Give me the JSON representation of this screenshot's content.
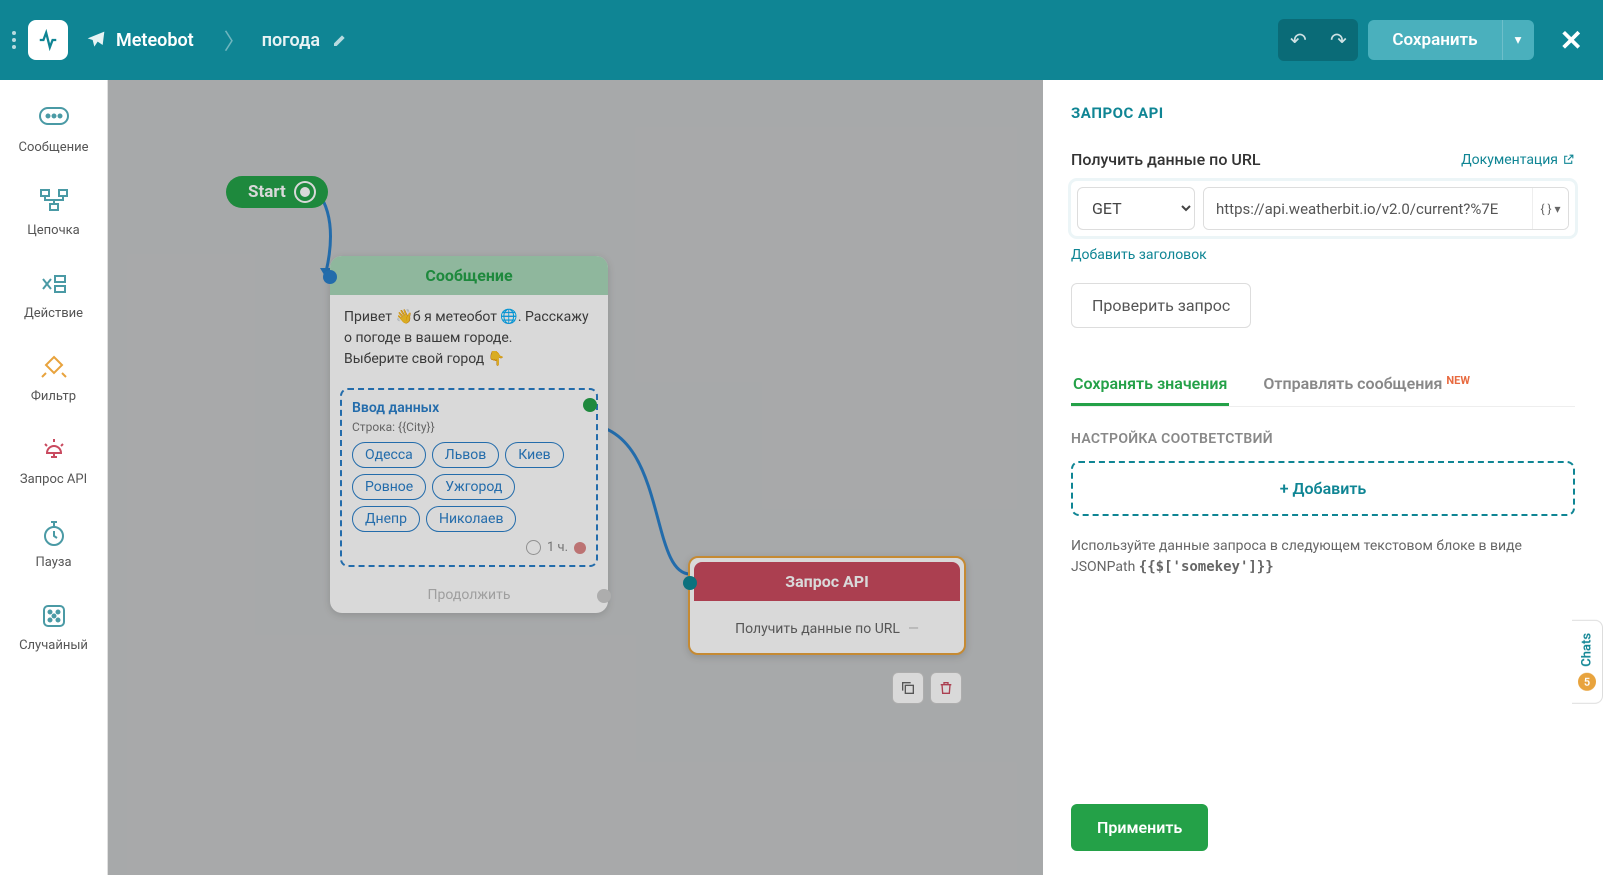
{
  "header": {
    "bot_name": "Meteobot",
    "crumb": "погода",
    "save": "Сохранить"
  },
  "sidebar": {
    "items": [
      {
        "label": "Сообщение"
      },
      {
        "label": "Цепочка"
      },
      {
        "label": "Действие"
      },
      {
        "label": "Фильтр"
      },
      {
        "label": "Запрос API"
      },
      {
        "label": "Пауза"
      },
      {
        "label": "Случайный"
      }
    ]
  },
  "canvas": {
    "start": "Start",
    "msg_title": "Сообщение",
    "msg_text": "Привет 👋б я метеобот 🌐. Расскажу о погоде в вашем городе.\nВыберите свой город 👇",
    "input_title": "Ввод данных",
    "input_sub": "Строка: {{City}}",
    "chips": [
      "Одесса",
      "Львов",
      "Киев",
      "Ровное",
      "Ужгород",
      "Днепр",
      "Николаев"
    ],
    "timer": "1 ч.",
    "continue": "Продолжить",
    "api_title": "Запрос API",
    "api_body": "Получить данные по URL"
  },
  "panel": {
    "title": "ЗАПРОС API",
    "field_label": "Получить данные по URL",
    "doc": "Документация",
    "method": "GET",
    "url": "https://api.weatherbit.io/v2.0/current?%7E",
    "add_header": "Добавить заголовок",
    "test": "Проверить запрос",
    "tab1": "Сохранять значения",
    "tab2": "Отправлять сообщения",
    "tab2_badge": "NEW",
    "map_section": "НАСТРОЙКА СООТВЕТСТВИЙ",
    "add_map": "+ Добавить",
    "hint_pre": "Используйте данные запроса в следующем текстовом блоке в виде JSONPath ",
    "hint_code": "{{$['somekey']}}",
    "apply": "Применить"
  },
  "chats": {
    "label": "Chats",
    "count": "5"
  }
}
